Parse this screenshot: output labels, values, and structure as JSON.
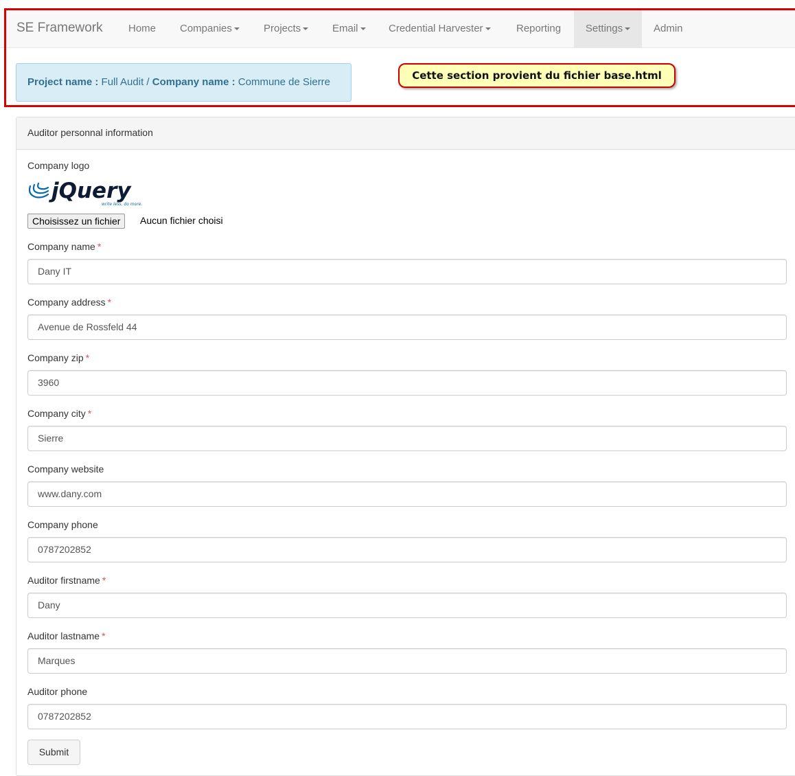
{
  "nav": {
    "brand": "SE Framework",
    "items": [
      {
        "label": "Home",
        "dropdown": false
      },
      {
        "label": "Companies",
        "dropdown": true
      },
      {
        "label": "Projects",
        "dropdown": true
      },
      {
        "label": "Email",
        "dropdown": true
      },
      {
        "label": "Credential Harvester",
        "dropdown": true
      },
      {
        "label": "Reporting",
        "dropdown": false
      },
      {
        "label": "Settings",
        "dropdown": true,
        "active": true
      },
      {
        "label": "Admin",
        "dropdown": false
      }
    ]
  },
  "alert": {
    "project_label": "Project name :",
    "project_value": "Full Audit /",
    "company_label": "Company name :",
    "company_value": "Commune de Sierre"
  },
  "callout": "Cette section provient du fichier base.html",
  "panel": {
    "heading": "Auditor personnal information",
    "logo_label": "Company logo",
    "logo": {
      "name": "jQuery",
      "tagline": "write less, do more."
    },
    "file_button": "Choisissez un fichier",
    "file_status": "Aucun fichier choisi",
    "fields": [
      {
        "label": "Company name",
        "required": true,
        "value": "Dany IT"
      },
      {
        "label": "Company address",
        "required": true,
        "value": "Avenue de Rossfeld 44"
      },
      {
        "label": "Company zip",
        "required": true,
        "value": "3960"
      },
      {
        "label": "Company city",
        "required": true,
        "value": "Sierre"
      },
      {
        "label": "Company website",
        "required": false,
        "value": "www.dany.com"
      },
      {
        "label": "Company phone",
        "required": false,
        "value": "0787202852"
      },
      {
        "label": "Auditor firstname",
        "required": true,
        "value": "Dany"
      },
      {
        "label": "Auditor lastname",
        "required": true,
        "value": "Marques"
      },
      {
        "label": "Auditor phone",
        "required": false,
        "value": "0787202852"
      }
    ],
    "required_mark": "*",
    "submit": "Submit"
  },
  "colors": {
    "alert_bg": "#d9edf7",
    "alert_text": "#31708f",
    "frame": "#d60000",
    "callout_bg": "#ffffb7",
    "required": "#d9534f"
  }
}
